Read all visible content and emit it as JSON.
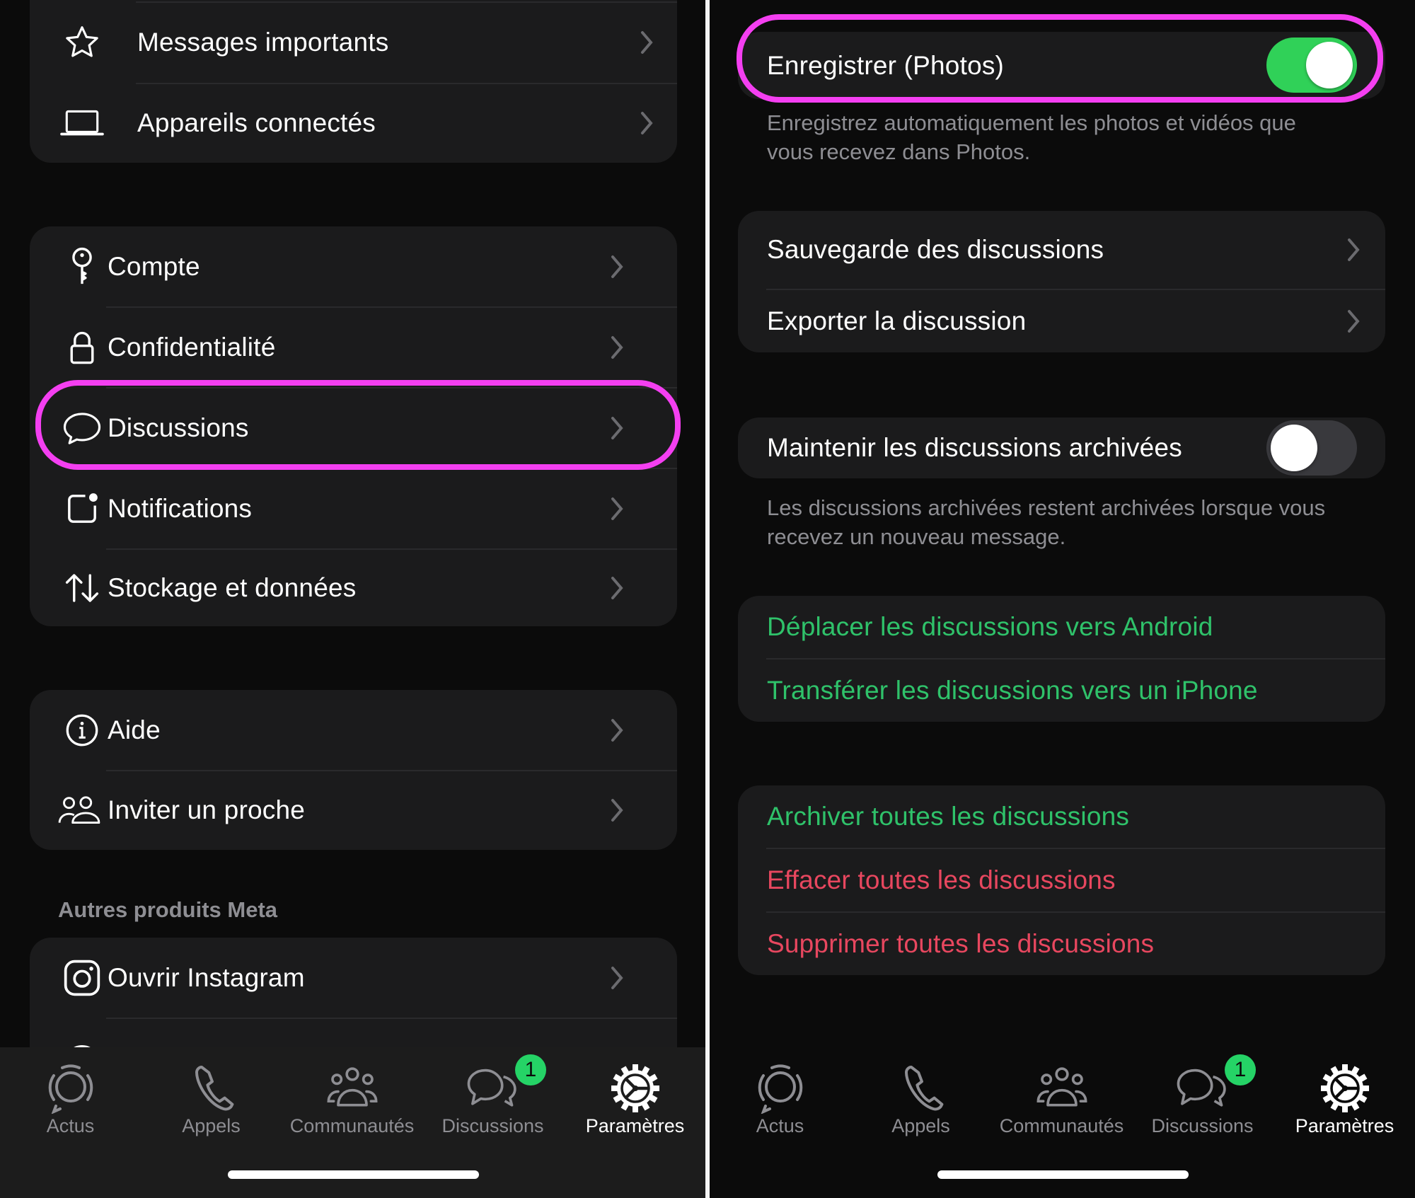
{
  "colors": {
    "background": "#0b0b0b",
    "card": "#1b1b1c",
    "highlight": "#f43ff1",
    "toggle_on": "#30d158",
    "green_text": "#2fc26a",
    "red_text": "#e8475f",
    "secondary_text": "#8e8e93",
    "badge": "#25d366"
  },
  "left_panel": {
    "card_top": {
      "items": [
        {
          "label": "Messages importants",
          "icon": "star-icon"
        },
        {
          "label": "Appareils connectés",
          "icon": "laptop-icon"
        }
      ]
    },
    "card_settings": {
      "items": [
        {
          "label": "Compte",
          "icon": "key-icon"
        },
        {
          "label": "Confidentialité",
          "icon": "lock-icon"
        },
        {
          "label": "Discussions",
          "icon": "chat-bubble-icon",
          "highlighted": true
        },
        {
          "label": "Notifications",
          "icon": "notification-badge-icon"
        },
        {
          "label": "Stockage et données",
          "icon": "up-down-arrows-icon"
        }
      ]
    },
    "card_help": {
      "items": [
        {
          "label": "Aide",
          "icon": "info-icon"
        },
        {
          "label": "Inviter un proche",
          "icon": "people-icon"
        }
      ]
    },
    "meta_section": {
      "title": "Autres produits Meta",
      "items": [
        {
          "label": "Ouvrir Instagram",
          "icon": "instagram-icon"
        }
      ]
    }
  },
  "right_panel": {
    "save_photos": {
      "label": "Enregistrer (Photos)",
      "enabled": true,
      "footnote_line1": "Enregistrez automatiquement les photos et vidéos que",
      "footnote_line2": "vous recevez dans Photos."
    },
    "backup_card": {
      "items": [
        {
          "label": "Sauvegarde des discussions"
        },
        {
          "label": "Exporter la discussion"
        }
      ]
    },
    "keep_archived": {
      "label": "Maintenir les discussions archivées",
      "enabled": false,
      "footnote_line1": "Les discussions archivées restent archivées lorsque vous",
      "footnote_line2": "recevez un nouveau message."
    },
    "transfer_card": {
      "items": [
        {
          "label": "Déplacer les discussions vers Android"
        },
        {
          "label": "Transférer les discussions vers un iPhone"
        }
      ]
    },
    "actions_card": {
      "items": [
        {
          "label": "Archiver toutes les discussions",
          "tone": "green"
        },
        {
          "label": "Effacer toutes les discussions",
          "tone": "red"
        },
        {
          "label": "Supprimer toutes les discussions",
          "tone": "red"
        }
      ]
    }
  },
  "tabbar": {
    "tabs": [
      {
        "label": "Actus",
        "icon": "updates-icon",
        "active": false
      },
      {
        "label": "Appels",
        "icon": "phone-icon",
        "active": false
      },
      {
        "label": "Communautés",
        "icon": "communities-icon",
        "active": false
      },
      {
        "label": "Discussions",
        "icon": "chats-icon",
        "active": false,
        "badge": "1"
      },
      {
        "label": "Paramètres",
        "icon": "settings-gear-icon",
        "active": true
      }
    ]
  }
}
